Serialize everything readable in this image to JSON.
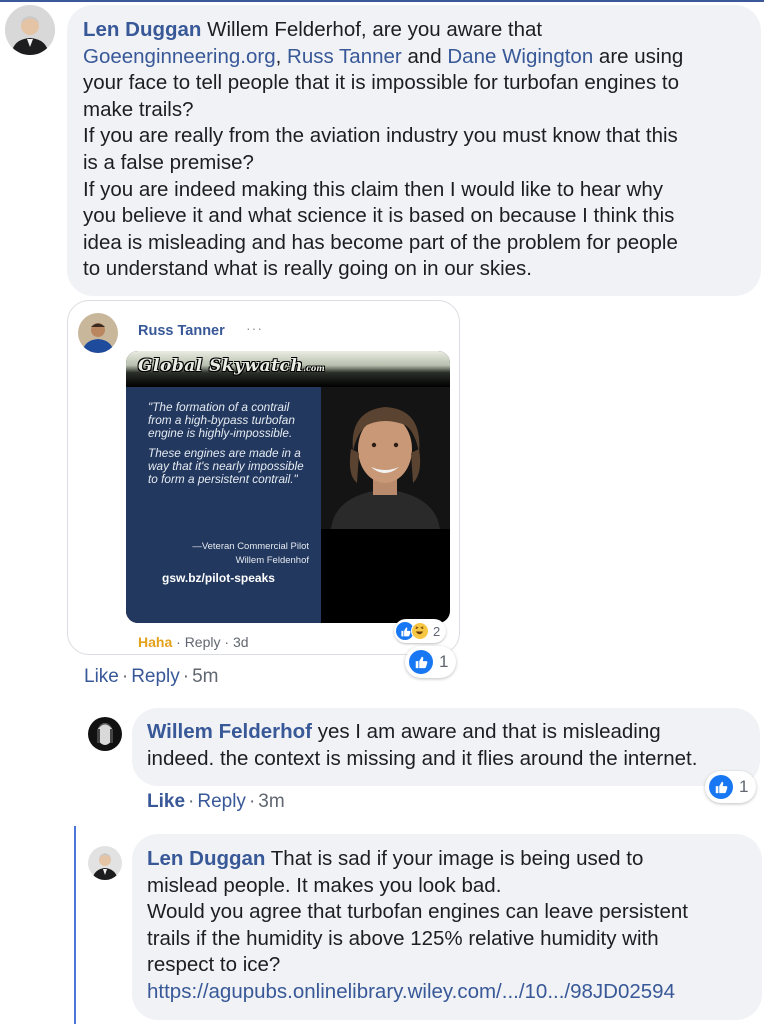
{
  "comments": [
    {
      "author": "Len Duggan",
      "lines": [
        [
          {
            "t": "Willem Felderhof, are you aware that"
          }
        ],
        [
          {
            "t": "Goeenginneering.org",
            "link": true
          },
          {
            "t": ", "
          },
          {
            "t": "Russ Tanner",
            "link": true
          },
          {
            "t": " and "
          },
          {
            "t": "Dane Wigington",
            "link": true
          },
          {
            "t": " are using"
          }
        ],
        [
          {
            "t": "your face to tell people that it is impossible for turbofan engines to"
          }
        ],
        [
          {
            "t": "make trails?"
          }
        ],
        [
          {
            "t": "If you are really from the aviation industry you must know that this"
          }
        ],
        [
          {
            "t": "is a false premise?"
          }
        ],
        [
          {
            "t": "If you are indeed making this claim then I would like to hear why"
          }
        ],
        [
          {
            "t": "you believe it and what science it is based on because I think this"
          }
        ],
        [
          {
            "t": "idea is misleading and has become part of the problem for people"
          }
        ],
        [
          {
            "t": "to understand what is really going on in our skies."
          }
        ]
      ],
      "like": "Like",
      "reply": "Reply",
      "time": "5m",
      "reaction_count": "1"
    },
    {
      "author": "Willem Felderhof",
      "lines": [
        [
          {
            "t": "yes I am aware and that is misleading"
          }
        ],
        [
          {
            "t": "indeed. the context is missing and it flies around the internet."
          }
        ]
      ],
      "like": "Like",
      "reply": "Reply",
      "time": "3m",
      "reaction_count": "1"
    },
    {
      "author": "Len Duggan",
      "lines": [
        [
          {
            "t": "That is sad if your image is being used to"
          }
        ],
        [
          {
            "t": "mislead people. It makes you look bad."
          }
        ],
        [
          {
            "t": "Would you agree that turbofan engines can leave persistent"
          }
        ],
        [
          {
            "t": "trails if the humidity is above 125% relative humidity with"
          }
        ],
        [
          {
            "t": "respect to ice?"
          }
        ],
        [
          {
            "t": "https://agupubs.onlinelibrary.wiley.com/.../10.../98JD02594",
            "link": true
          }
        ]
      ]
    }
  ],
  "embedded_post": {
    "author": "Russ Tanner",
    "more": "···",
    "poster": {
      "brand": "Global Skywatch",
      "brand_suffix": ".com",
      "quote_1": "\"The formation of a contrail from a high-bypass turbofan engine is highly-impossible.",
      "quote_2": "These engines are made in a way that it's nearly impossible to form a persistent contrail.\"",
      "attribution_1": "—Veteran Commercial Pilot",
      "attribution_2": "Willem Feldenhof",
      "url": "gsw.bz/pilot-speaks"
    },
    "reaction_label": "Haha",
    "reply": "Reply",
    "time": "3d",
    "reaction_count": "2"
  },
  "colors": {
    "link": "#385898",
    "bubble": "#f0f2f5",
    "like_blue": "#1877f2",
    "haha": "#e4a11b",
    "thread_line": "#4a76d9"
  }
}
